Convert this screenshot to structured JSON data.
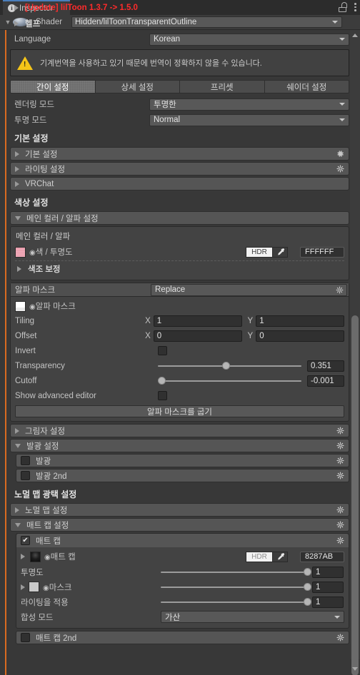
{
  "window": {
    "tab_label": "Inspector",
    "info_icon": "info-icon",
    "lock_icon": "lock-open-icon",
    "menu_icon": "kebab-menu-icon"
  },
  "shader": {
    "label": "Shader",
    "value": "Hidden/lilToonTransparentOutline"
  },
  "update_notice": "[Update] lilToon 1.3.7 -> 1.5.0",
  "help_label": "헬프",
  "language": {
    "label": "Language",
    "value": "Korean"
  },
  "warning": "기계번역을 사용하고 있기 때문에 번역이 정확하지 않을 수 있습니다.",
  "tabs": [
    {
      "label": "간이 설정",
      "active": true
    },
    {
      "label": "상세 설정",
      "active": false
    },
    {
      "label": "프리셋",
      "active": false
    },
    {
      "label": "쉐이더 설정",
      "active": false
    }
  ],
  "rendering_mode": {
    "label": "렌더링 모드",
    "value": "투명한"
  },
  "transparent_mode": {
    "label": "투명 모드",
    "value": "Normal"
  },
  "basic_section": {
    "title": "기본 설정",
    "items": [
      {
        "label": "기본 설정",
        "expanded": false,
        "gear": true
      },
      {
        "label": "라이팅 설정",
        "expanded": false,
        "gear": true
      },
      {
        "label": "VRChat",
        "expanded": false,
        "gear": false
      }
    ]
  },
  "color_section": {
    "title": "색상 설정",
    "main_color_foldout": "메인 컬러 / 알파 설정",
    "main_color_box_title": "메인 컬러 / 알파",
    "color_row": {
      "label": "색 / 투명도",
      "hdr_label": "HDR",
      "hex": "FFFFFF",
      "swatch": "pink-texture-thumb"
    },
    "hue_correction": "색조 보정",
    "alpha_mask": {
      "label": "알파 마스크",
      "mode": "Replace",
      "texture_label": "알파 마스크",
      "tiling": {
        "label": "Tiling",
        "x": "1",
        "y": "1"
      },
      "offset": {
        "label": "Offset",
        "x": "0",
        "y": "0"
      },
      "invert": {
        "label": "Invert",
        "checked": false
      },
      "transparency": {
        "label": "Transparency",
        "value": "0.351",
        "pct": 45
      },
      "cutoff": {
        "label": "Cutoff",
        "value": "-0.001",
        "pct": 2
      },
      "show_advanced": {
        "label": "Show advanced editor",
        "checked": false
      },
      "bake_button": "알파 마스크를 굽기"
    }
  },
  "shadow_section": {
    "label": "그림자 설정",
    "expanded": false,
    "gear": true
  },
  "emission_section": {
    "label": "발광 설정",
    "expanded": true,
    "gear": true,
    "items": [
      {
        "label": "발광",
        "checked": false,
        "gear": true
      },
      {
        "label": "발광 2nd",
        "checked": false,
        "gear": true
      }
    ]
  },
  "normal_section": {
    "title": "노멀 맵 광택 설정",
    "normal_map": {
      "label": "노멀 맵 설정",
      "expanded": false,
      "gear": true
    },
    "matcap_settings": {
      "label": "매트 캡 설정",
      "expanded": true,
      "gear": true
    }
  },
  "matcap": {
    "label": "매트 캡",
    "checked": true,
    "gear": true,
    "tex_label": "매트 캡",
    "hdr_label": "HDR",
    "hex": "8287AB",
    "transparency": {
      "label": "투명도",
      "value": "1",
      "pct": 97
    },
    "mask": {
      "label": "마스크",
      "value": "1",
      "pct": 97
    },
    "apply_lighting": {
      "label": "라이팅을 적용",
      "value": "1",
      "pct": 97
    },
    "blend_mode": {
      "label": "합성 모드",
      "value": "가산"
    },
    "matcap_2nd": {
      "label": "매트 캡 2nd",
      "checked": false,
      "gear": true
    }
  },
  "colors": {
    "accent_orange": "#d96a20",
    "tab_underline": "#4a7ebb",
    "warning_yellow": "#f5c518",
    "update_red": "#ff2b2b",
    "panel_bg": "#383838"
  }
}
